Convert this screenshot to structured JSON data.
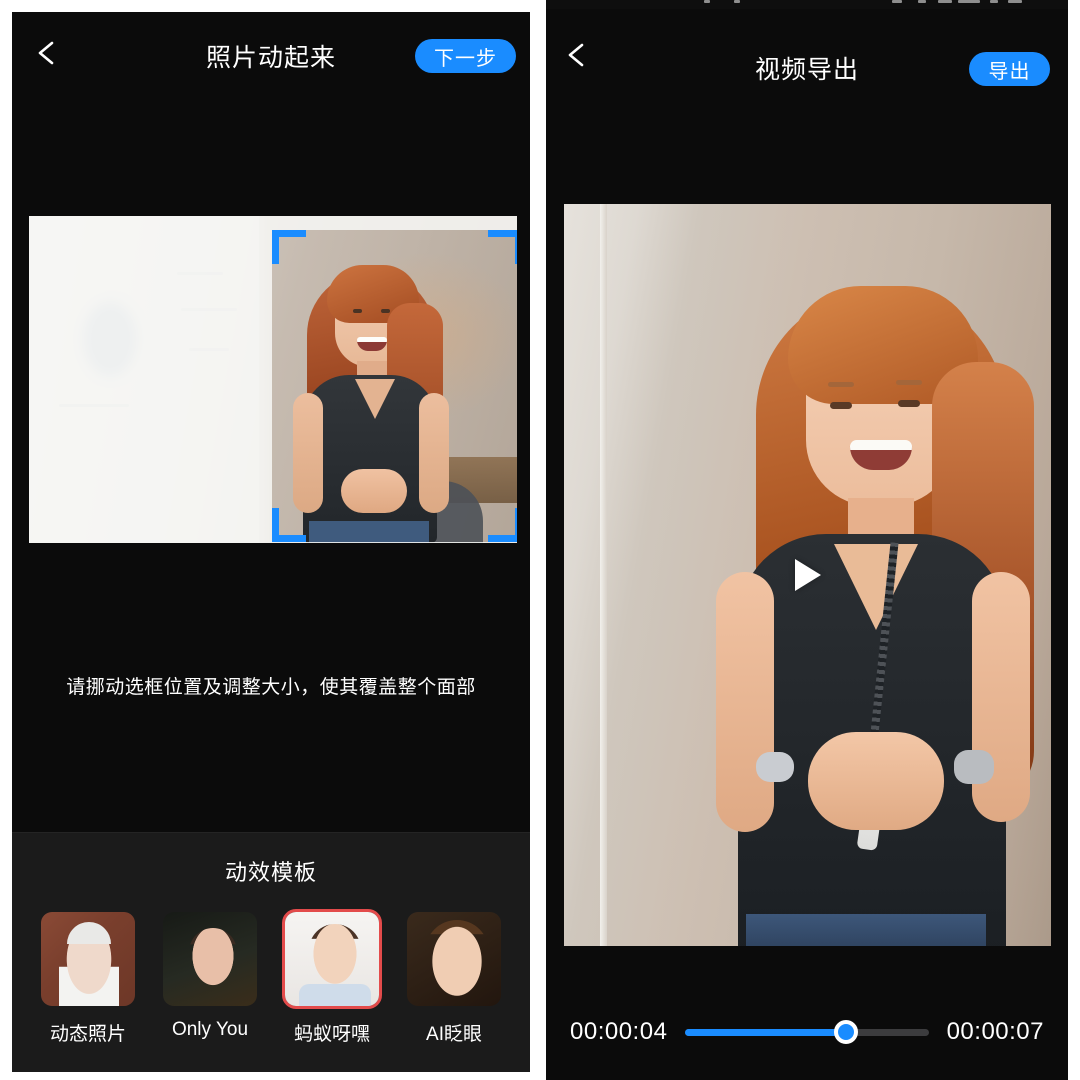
{
  "left_screen": {
    "nav": {
      "back_icon": "chevron-left-icon",
      "title": "照片动起来",
      "next_label": "下一步"
    },
    "hint": "请挪动选框位置及调整大小，使其覆盖整个面部",
    "selection_box": {
      "corner_color": "#1a8cff",
      "corners": [
        "top-left",
        "top-right",
        "bottom-left",
        "bottom-right"
      ]
    },
    "templates": {
      "title": "动效模板",
      "selected_index": 2,
      "selected_border_color": "#e34b4b",
      "items": [
        {
          "label": "动态照片"
        },
        {
          "label": "Only You"
        },
        {
          "label": "蚂蚁呀嘿"
        },
        {
          "label": "AI眨眼"
        }
      ]
    }
  },
  "right_screen": {
    "nav": {
      "back_icon": "chevron-left-icon",
      "title": "视频导出",
      "export_label": "导出"
    },
    "player": {
      "play_icon": "play-icon",
      "current_time": "00:00:04",
      "total_time": "00:00:07",
      "progress_percent": 66
    }
  },
  "theme": {
    "accent": "#1a8cff",
    "background": "#0b0b0b",
    "tray_background": "#1b1b1b",
    "text": "#ffffff",
    "track_inactive": "#3c3c3e"
  }
}
